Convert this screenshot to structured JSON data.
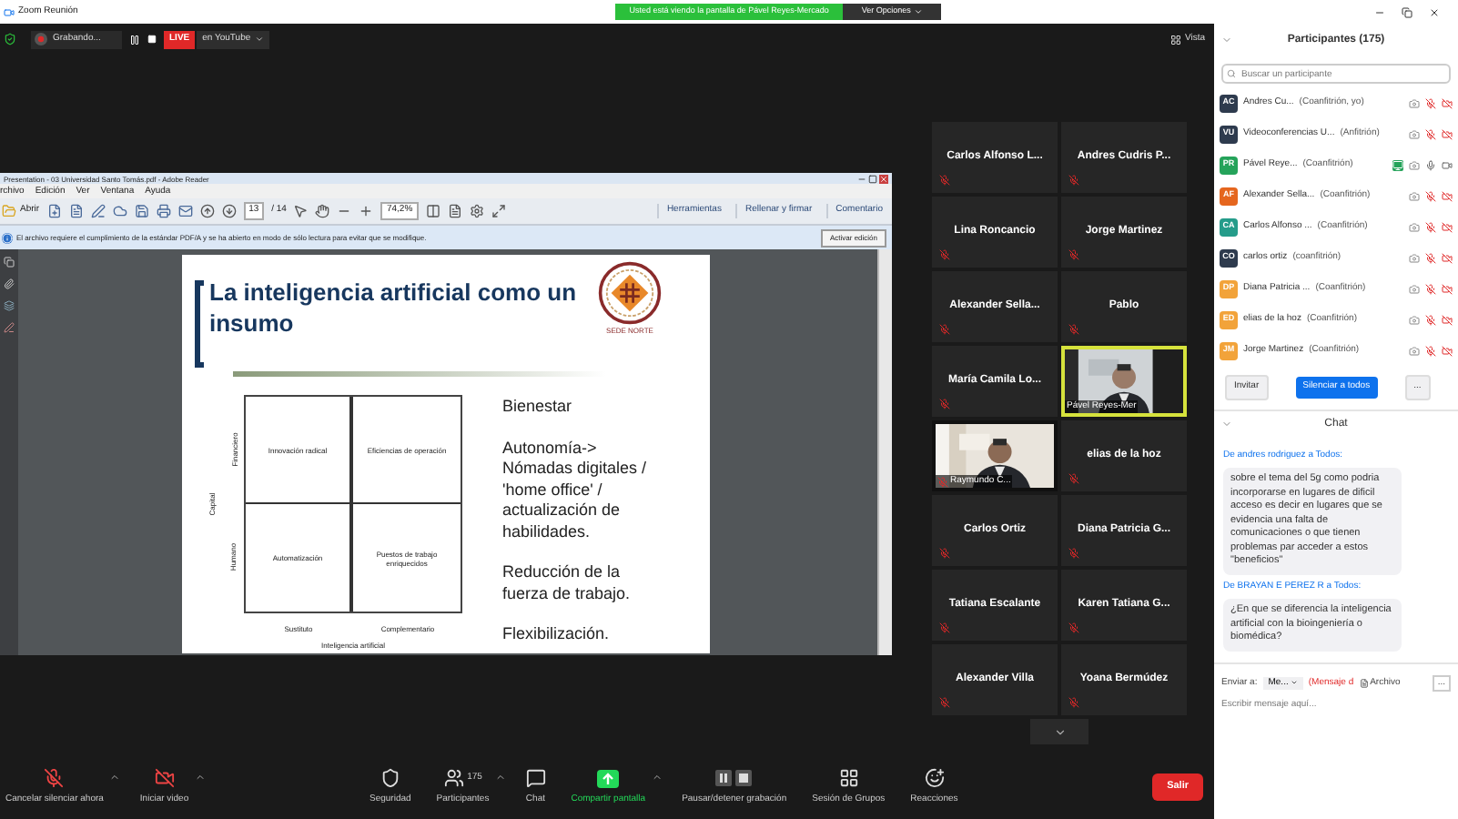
{
  "window": {
    "title": "Zoom Reunión"
  },
  "share_banner": {
    "text": "Usted está viendo la pantalla de Pável Reyes-Mercado",
    "options": "Ver Opciones"
  },
  "top_bar": {
    "recording": "Grabando...",
    "live": "LIVE",
    "live_target": "en YouTube",
    "view": "Vista"
  },
  "reader": {
    "title": "Presentation - 03 Universidad Santo Tomás.pdf - Adobe Reader",
    "menu": [
      "rchivo",
      "Edición",
      "Ver",
      "Ventana",
      "Ayuda"
    ],
    "open": "Abrir",
    "page": "13",
    "page_total": "/ 14",
    "zoom": "74,2%",
    "panels": [
      "Herramientas",
      "Rellenar y firmar",
      "Comentario"
    ],
    "notice": "El archivo requiere el cumplimiento de la estándar PDF/A y se ha abierto en modo de sólo lectura para evitar que se modifique.",
    "notice_button": "Activar edición",
    "slide": {
      "title": "La inteligencia artificial como un insumo",
      "logo_caption": "SEDE NORTE",
      "matrix": {
        "y_title": "Capital",
        "rows": [
          "Financiero",
          "Humano"
        ],
        "cells": [
          "Innovación radical",
          "Eficiencias de operación",
          "Automatización",
          "Puestos de trabajo enriquecidos"
        ],
        "columns": [
          "Sustituto",
          "Complementario"
        ],
        "x_title": "Inteligencia artificial"
      },
      "points": [
        "Bienestar",
        "Autonomía-> Nómadas digitales / 'home office' / actualización de habilidades.",
        "Reducción de la fuerza de trabajo.",
        "Flexibilización."
      ]
    }
  },
  "video_tiles": [
    {
      "kind": "name",
      "name": "Carlos Alfonso L...",
      "muted": true,
      "speaking": false
    },
    {
      "kind": "name",
      "name": "Andres Cudris P...",
      "muted": true,
      "speaking": false
    },
    {
      "kind": "name",
      "name": "Lina Roncancio",
      "muted": true,
      "speaking": false
    },
    {
      "kind": "name",
      "name": "Jorge Martinez",
      "muted": true,
      "speaking": false
    },
    {
      "kind": "name",
      "name": "Alexander Sella...",
      "muted": true,
      "speaking": false
    },
    {
      "kind": "name",
      "name": "Pablo",
      "muted": true,
      "speaking": false
    },
    {
      "kind": "name",
      "name": "María Camila Lo...",
      "muted": true,
      "speaking": false
    },
    {
      "kind": "video",
      "name": "Pável Reyes-Mer",
      "muted": false,
      "speaking": true
    },
    {
      "kind": "video",
      "name": "Raymundo C...",
      "muted": true,
      "speaking": false
    },
    {
      "kind": "name",
      "name": "elias de la hoz",
      "muted": true,
      "speaking": false
    },
    {
      "kind": "name",
      "name": "Carlos Ortiz",
      "muted": true,
      "speaking": false
    },
    {
      "kind": "name",
      "name": "Diana Patricia G...",
      "muted": true,
      "speaking": false
    },
    {
      "kind": "name",
      "name": "Tatiana Escalante",
      "muted": true,
      "speaking": false
    },
    {
      "kind": "name",
      "name": "Karen Tatiana G...",
      "muted": true,
      "speaking": false
    },
    {
      "kind": "name",
      "name": "Alexander Villa",
      "muted": true,
      "speaking": false
    },
    {
      "kind": "name",
      "name": "Yoana Bermúdez",
      "muted": true,
      "speaking": false
    }
  ],
  "toolbar": {
    "items": [
      {
        "kind": "mic",
        "label": "Cancelar silenciar ahora"
      },
      {
        "kind": "video",
        "label": "Iniciar video"
      },
      {
        "kind": "security",
        "label": "Seguridad"
      },
      {
        "kind": "participants",
        "label": "Participantes",
        "count": "175"
      },
      {
        "kind": "chat",
        "label": "Chat"
      },
      {
        "kind": "share",
        "label": "Compartir pantalla"
      },
      {
        "kind": "record",
        "label": "Pausar/detener grabación"
      },
      {
        "kind": "breakout",
        "label": "Sesión de Grupos"
      },
      {
        "kind": "reactions",
        "label": "Reacciones"
      }
    ],
    "leave": "Salir"
  },
  "participants": {
    "title": "Participantes (175)",
    "search": {
      "placeholder": "Buscar un participante"
    },
    "items": [
      {
        "initials": "AC",
        "color": "#2e3b4e",
        "name": "Andres Cu...",
        "role": "(Coanfitrión, yo)",
        "sharing": false,
        "video_on": false,
        "muted": true
      },
      {
        "initials": "VU",
        "color": "#2e3b4e",
        "name": "Videoconferencias U...",
        "role": "(Anfitrión)",
        "sharing": false,
        "video_on": false,
        "muted": true
      },
      {
        "initials": "PR",
        "color": "#25a35a",
        "name": "Pável Reye...",
        "role": "(Coanfitrión)",
        "sharing": true,
        "video_on": true,
        "muted": false
      },
      {
        "initials": "AF",
        "color": "#e5661e",
        "name": "Alexander Sella...",
        "role": "(Coanfitrión)",
        "sharing": false,
        "video_on": false,
        "muted": true
      },
      {
        "initials": "CA",
        "color": "#259c8a",
        "name": "Carlos Alfonso ...",
        "role": "(Coanfitrión)",
        "sharing": false,
        "video_on": false,
        "muted": true
      },
      {
        "initials": "CO",
        "color": "#2e3b4e",
        "name": "carlos ortiz",
        "role": "(coanfitrión)",
        "sharing": false,
        "video_on": false,
        "muted": true
      },
      {
        "initials": "DP",
        "color": "#f2a33a",
        "name": "Diana Patricia ...",
        "role": "(Coanfitrión)",
        "sharing": false,
        "video_on": false,
        "muted": true
      },
      {
        "initials": "ED",
        "color": "#f2a33a",
        "name": "elias de la hoz",
        "role": "(Coanfitrión)",
        "sharing": false,
        "video_on": false,
        "muted": true
      },
      {
        "initials": "JM",
        "color": "#f2a33a",
        "name": "Jorge Martinez",
        "role": "(Coanfitrión)",
        "sharing": false,
        "video_on": false,
        "muted": true
      }
    ],
    "buttons": [
      {
        "kind": "plain",
        "label": "Invitar"
      },
      {
        "kind": "primary",
        "label": "Silenciar a todos"
      },
      {
        "kind": "plain",
        "label": "..."
      }
    ]
  },
  "chat": {
    "title": "Chat",
    "messages": [
      {
        "header": "De andres rodriguez a Todos:",
        "text": "sobre el tema del 5g como podria incorporarse en lugares de dificil acceso es decir en lugares que se evidencia una falta de comunicaciones o que tienen problemas par acceder a estos \"beneficios\""
      },
      {
        "header": "De BRAYAN E PEREZ R a Todos:",
        "text": "¿En que se diferencia la inteligencia artificial con la bioingeniería o biomédica?"
      }
    ],
    "send_to_label": "Enviar a:",
    "recipient": "Me...",
    "direct_note": "(Mensaje d",
    "file": "Archivo",
    "more": "...",
    "input": {
      "placeholder": "Escribir mensaje aquí..."
    }
  }
}
